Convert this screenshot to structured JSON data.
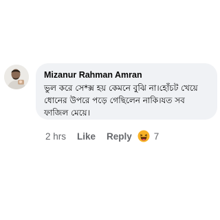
{
  "comment": {
    "author": "Mizanur Rahman Amran",
    "text": "ভুল করে সে*ক্স হয় কেমনে বুঝি না।হোঁচট খেয়ে ধোনের উপরে পড়ে গেছিলেন নাকি।যত সব ফাজিল মেয়ে।",
    "time": "2 hrs",
    "like_label": "Like",
    "reply_label": "Reply",
    "reaction_icon": "haha-reaction-icon",
    "reaction_count": "7"
  },
  "colors": {
    "bubble": "#f0f2f5",
    "muted_text": "#65676b",
    "text": "#050505",
    "reaction": "#f7b125"
  }
}
